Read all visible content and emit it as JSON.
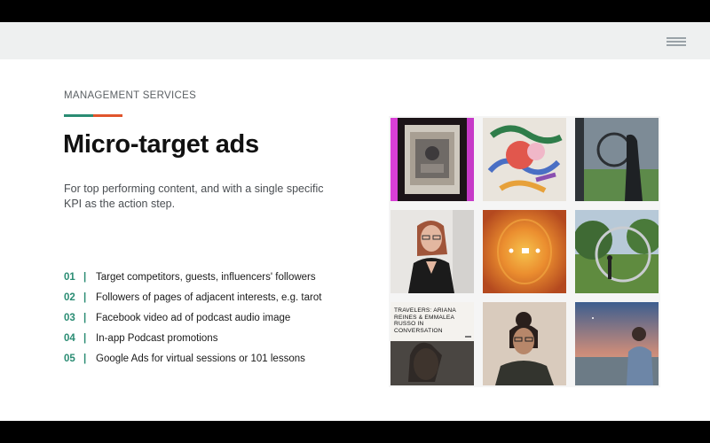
{
  "slide": {
    "eyebrow": "MANAGEMENT SERVICES",
    "title": "Micro-target ads",
    "subtitle": "For top performing content, and with a single specific KPI as the action step.",
    "accent_colors": {
      "teal": "#2a8c73",
      "orange": "#e0552c",
      "number": "#2a8c73"
    },
    "separator": "|",
    "items": [
      {
        "number": "01",
        "text": "Target competitors, guests, influencers' followers"
      },
      {
        "number": "02",
        "text": "Followers of pages of adjacent interests, e.g. tarot"
      },
      {
        "number": "03",
        "text": "Facebook video ad of podcast audio image"
      },
      {
        "number": "04",
        "text": "In-app Podcast promotions"
      },
      {
        "number": "05",
        "text": "Google Ads for virtual sessions or 101 lessons"
      }
    ]
  },
  "topbar": {
    "menu_icon": "hamburger-menu-icon"
  },
  "image_grid": {
    "tiles": [
      {
        "name": "framed-artwork-photo"
      },
      {
        "name": "abstract-painting-photo"
      },
      {
        "name": "silhouette-window-photo"
      },
      {
        "name": "woman-glasses-portrait-photo"
      },
      {
        "name": "orange-gradient-podcast-photo"
      },
      {
        "name": "ring-sculpture-park-photo"
      },
      {
        "name": "travelers-conversation-title-photo",
        "caption": "TRAVELERS: ARIANA REINES & EMMALEA RUSSO IN CONVERSATION"
      },
      {
        "name": "woman-portrait-photo"
      },
      {
        "name": "beach-sunset-portrait-photo"
      }
    ]
  }
}
